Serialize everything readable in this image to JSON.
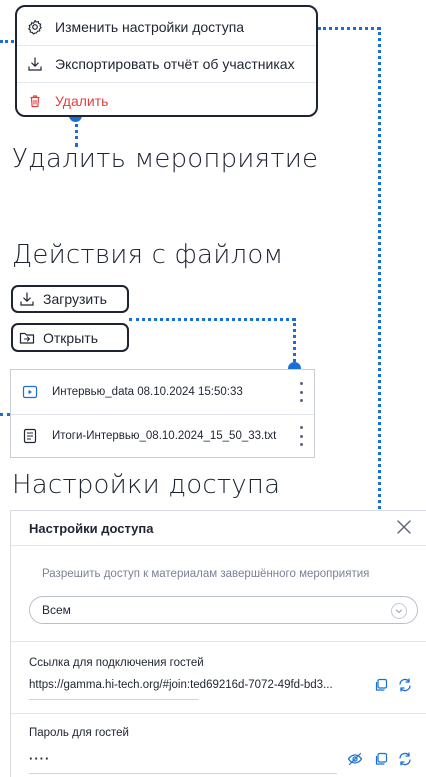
{
  "menu": {
    "items": [
      {
        "label": "Изменить настройки доступа",
        "icon": "gear-icon"
      },
      {
        "label": "Экспортировать отчёт об участниках",
        "icon": "download-icon"
      },
      {
        "label": "Удалить",
        "icon": "trash-icon"
      }
    ]
  },
  "headings": {
    "delete_event": "Удалить мероприятие",
    "file_actions": "Действия с файлом",
    "access_settings": "Настройки доступа"
  },
  "file_actions": {
    "upload_label": "Загрузить",
    "open_label": "Открыть"
  },
  "files": [
    {
      "name": "Интервью_data 08.10.2024 15:50:33",
      "icon": "video-file-icon"
    },
    {
      "name": "Итоги-Интервью_08.10.2024_15_50_33.txt",
      "icon": "text-file-icon"
    }
  ],
  "panel": {
    "title": "Настройки доступа",
    "allow_access_text": "Разрешить доступ к материалам завершённого мероприятия",
    "access_select_value": "Всем",
    "guest_link_label": "Ссылка для подключения гостей",
    "guest_link_value": "https://gamma.hi-tech.org/#join:ted69216d-7072-49fd-bd3...",
    "guest_password_label": "Пароль для гостей",
    "guest_password_value": "····"
  },
  "colors": {
    "accent": "#1a6fd6",
    "danger": "#e0413e",
    "text": "#1f2433"
  }
}
